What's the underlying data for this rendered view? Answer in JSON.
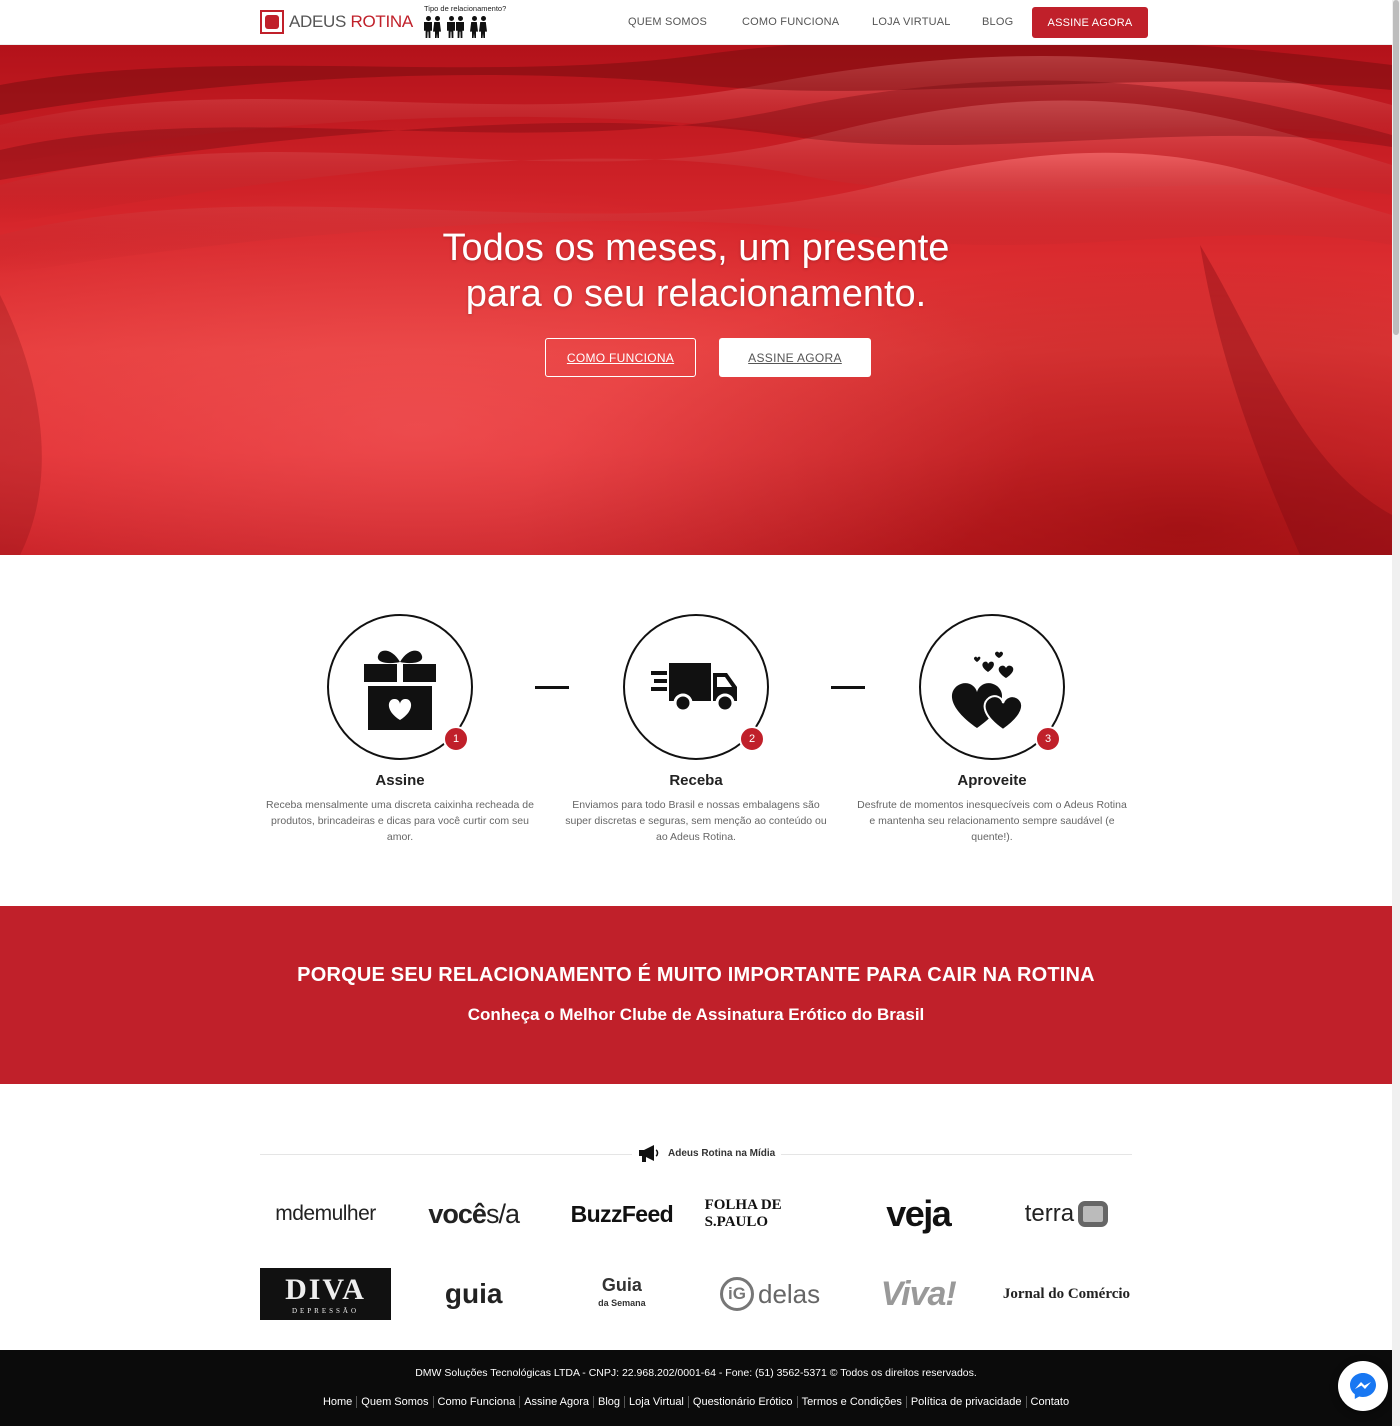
{
  "header": {
    "logo_left": "ADEUS",
    "logo_right": "ROTINA",
    "relationship_label": "Tipo de relacionamento?",
    "relationship_icons": [
      "couple-hetero-icon",
      "couple-male-icon",
      "couple-female-icon"
    ],
    "nav": {
      "quem_somos": "QUEM SOMOS",
      "como_funciona": "COMO FUNCIONA",
      "loja_virtual": "LOJA VIRTUAL",
      "blog": "BLOG",
      "assine_agora": "ASSINE AGORA"
    }
  },
  "hero": {
    "title_line1": "Todos os meses, um presente",
    "title_line2": "para o seu relacionamento.",
    "button_como": "COMO FUNCIONA",
    "button_assine": "ASSINE AGORA"
  },
  "steps": [
    {
      "number": "1",
      "icon": "gift-icon",
      "title": "Assine",
      "text": "Receba mensalmente uma discreta caixinha recheada de produtos, brincadeiras e dicas para você curtir com seu amor."
    },
    {
      "number": "2",
      "icon": "truck-icon",
      "title": "Receba",
      "text": "Enviamos para todo Brasil e nossas embalagens são super discretas e seguras, sem menção ao conteúdo ou ao Adeus Rotina."
    },
    {
      "number": "3",
      "icon": "hearts-icon",
      "title": "Aproveite",
      "text": "Desfrute de momentos inesquecíveis com o Adeus Rotina e mantenha seu relacionamento sempre saudável (e quente!)."
    }
  ],
  "band": {
    "title": "PORQUE SEU RELACIONAMENTO É MUITO IMPORTANTE PARA CAIR NA ROTINA",
    "subtitle": "Conheça o Melhor Clube de Assinatura Erótico do Brasil"
  },
  "media": {
    "label": "Adeus Rotina na Mídia",
    "row1": {
      "mdemulher": "mdemulher",
      "voce_a": "você",
      "voce_b": "s/a",
      "buzzfeed": "BuzzFeed",
      "folha": "FOLHA DE S.PAULO",
      "veja": "veja",
      "terra": "terra"
    },
    "row2": {
      "diva": "DIVA",
      "diva_sub": "DEPRESSÃO",
      "guia": "guia",
      "guia_semana_a": "Guia",
      "guia_semana_b": "da Semana",
      "delas": "delas",
      "delas_ig": "iG",
      "viva": "Viva!",
      "jornal": "Jornal do Comércio"
    }
  },
  "footer": {
    "copyright": "DMW Soluções Tecnológicas LTDA - CNPJ: 22.968.202/0001-64 - Fone: (51) 3562-5371 © Todos os direitos reservados.",
    "links": [
      "Home",
      "Quem Somos",
      "Como Funciona",
      "Assine Agora",
      "Blog",
      "Loja Virtual",
      "Questionário Erótico",
      "Termos e Condições",
      "Política de privacidade",
      "Contato"
    ]
  },
  "colors": {
    "brand_red": "#c0202a",
    "footer_bg": "#0b0b0b"
  }
}
